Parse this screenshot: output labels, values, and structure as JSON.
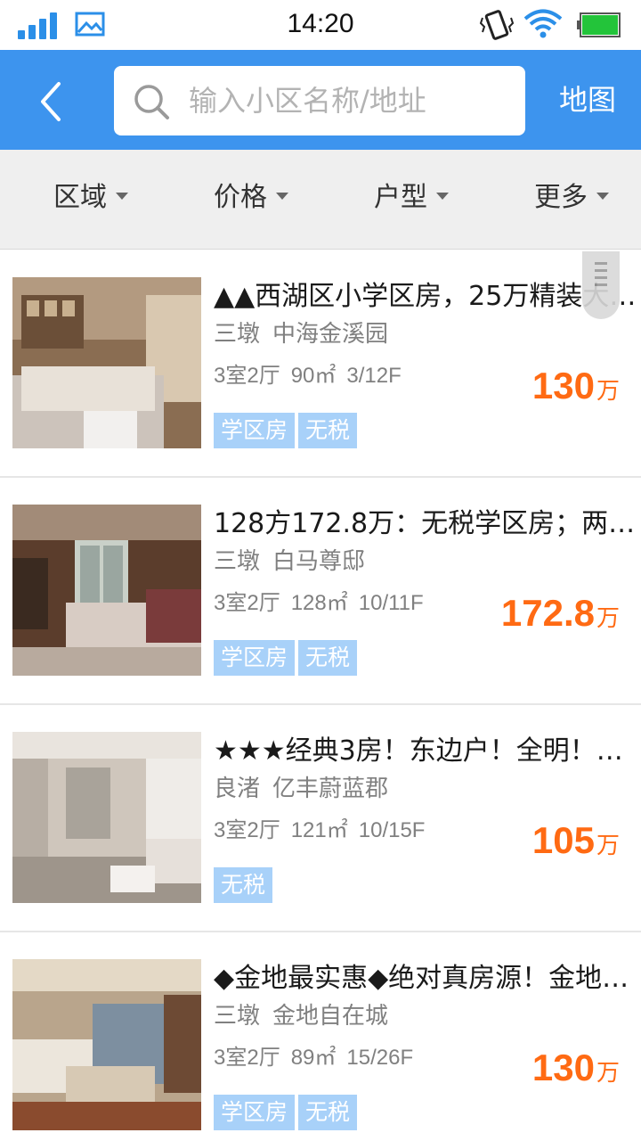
{
  "status_bar": {
    "time": "14:20"
  },
  "header": {
    "search_placeholder": "输入小区名称/地址",
    "map_label": "地图"
  },
  "filters": [
    {
      "label": "区域"
    },
    {
      "label": "价格"
    },
    {
      "label": "户型"
    },
    {
      "label": "更多"
    }
  ],
  "listings": [
    {
      "title": "▲▲西湖区小学区房，25万精装大…",
      "district": "三墩",
      "community": "中海金溪园",
      "layout": "3室2厅",
      "area": "90㎡",
      "floor": "3/12F",
      "price": "130",
      "price_unit": "万",
      "tags": [
        "学区房",
        "无税"
      ]
    },
    {
      "title": "128方172.8万：无税学区房；两…",
      "district": "三墩",
      "community": "白马尊邸",
      "layout": "3室2厅",
      "area": "128㎡",
      "floor": "10/11F",
      "price": "172.8",
      "price_unit": "万",
      "tags": [
        "学区房",
        "无税"
      ]
    },
    {
      "title": "★★★经典3房！东边户！全明！…",
      "district": "良渚",
      "community": "亿丰蔚蓝郡",
      "layout": "3室2厅",
      "area": "121㎡",
      "floor": "10/15F",
      "price": "105",
      "price_unit": "万",
      "tags": [
        "无税"
      ]
    },
    {
      "title": "◆金地最实惠◆绝对真房源！金地…",
      "district": "三墩",
      "community": "金地自在城",
      "layout": "3室2厅",
      "area": "89㎡",
      "floor": "15/26F",
      "price": "130",
      "price_unit": "万",
      "tags": [
        "学区房",
        "无税"
      ]
    }
  ],
  "colors": {
    "header_blue": "#3d94ee",
    "price_orange": "#ff6a13",
    "tag_blue": "#a8d1f9"
  },
  "icons": [
    "signal-icon",
    "image-icon",
    "vibrate-icon",
    "wifi-icon",
    "battery-icon",
    "back-arrow-icon",
    "search-icon",
    "caret-down-icon"
  ]
}
